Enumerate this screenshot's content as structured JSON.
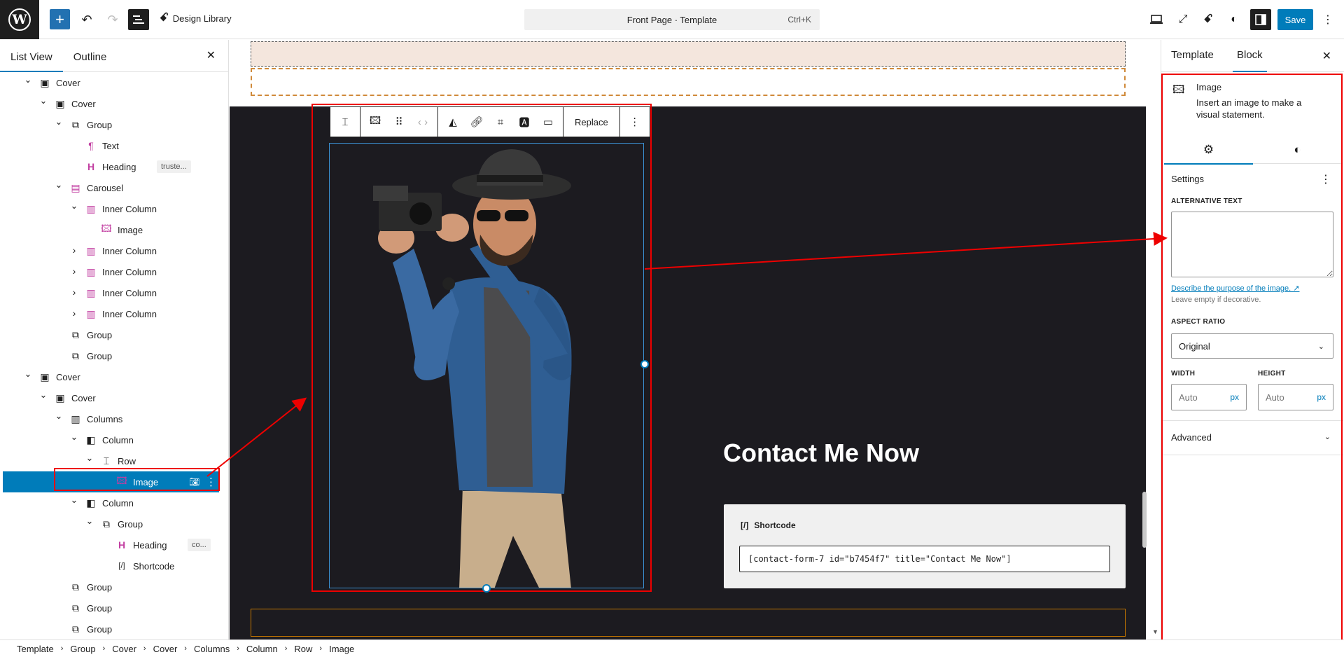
{
  "topbar": {
    "logo_glyph": "W",
    "design_library_label": "Design Library",
    "command_title": "Front Page · Template",
    "command_shortcut": "Ctrl+K",
    "save_label": "Save",
    "icons": [
      "add-block-icon",
      "undo-icon",
      "redo-icon",
      "document-overview-icon",
      "desktop-view-icon",
      "external-link-icon",
      "spectra-icon",
      "styles-icon",
      "settings-sidebar-icon",
      "more-options-icon"
    ]
  },
  "left_panel": {
    "tabs": [
      "List View",
      "Outline"
    ],
    "tree": [
      {
        "label": "Cover",
        "depth": 0,
        "expanded": true,
        "icon": "cover"
      },
      {
        "label": "Cover",
        "depth": 1,
        "expanded": true,
        "icon": "cover"
      },
      {
        "label": "Group",
        "depth": 2,
        "expanded": true,
        "icon": "group"
      },
      {
        "label": "Text",
        "depth": 3,
        "icon": "paragraph"
      },
      {
        "label": "Heading",
        "depth": 3,
        "icon": "heading",
        "badge": "truste..."
      },
      {
        "label": "Carousel",
        "depth": 2,
        "expanded": true,
        "icon": "carousel"
      },
      {
        "label": "Inner Column",
        "depth": 3,
        "expanded": true,
        "icon": "inner-column"
      },
      {
        "label": "Image",
        "depth": 4,
        "icon": "image"
      },
      {
        "label": "Inner Column",
        "depth": 3,
        "expanded": false,
        "icon": "inner-column"
      },
      {
        "label": "Inner Column",
        "depth": 3,
        "expanded": false,
        "icon": "inner-column"
      },
      {
        "label": "Inner Column",
        "depth": 3,
        "expanded": false,
        "icon": "inner-column"
      },
      {
        "label": "Inner Column",
        "depth": 3,
        "expanded": false,
        "icon": "inner-column"
      },
      {
        "label": "Group",
        "depth": 2,
        "icon": "group"
      },
      {
        "label": "Group",
        "depth": 2,
        "icon": "group"
      },
      {
        "label": "Cover",
        "depth": 0,
        "expanded": true,
        "icon": "cover"
      },
      {
        "label": "Cover",
        "depth": 1,
        "expanded": true,
        "icon": "cover"
      },
      {
        "label": "Columns",
        "depth": 2,
        "expanded": true,
        "icon": "columns"
      },
      {
        "label": "Column",
        "depth": 3,
        "expanded": true,
        "icon": "column"
      },
      {
        "label": "Row",
        "depth": 4,
        "expanded": true,
        "icon": "row"
      },
      {
        "label": "Image",
        "depth": 5,
        "icon": "image",
        "selected": true
      },
      {
        "label": "Column",
        "depth": 3,
        "expanded": true,
        "icon": "column"
      },
      {
        "label": "Group",
        "depth": 4,
        "expanded": true,
        "icon": "group"
      },
      {
        "label": "Heading",
        "depth": 5,
        "icon": "heading",
        "badge": "co..."
      },
      {
        "label": "Shortcode",
        "depth": 5,
        "icon": "shortcode"
      },
      {
        "label": "Group",
        "depth": 2,
        "icon": "group"
      },
      {
        "label": "Group",
        "depth": 2,
        "icon": "group"
      },
      {
        "label": "Group",
        "depth": 2,
        "icon": "group"
      }
    ]
  },
  "canvas": {
    "toolbar_replace_label": "Replace",
    "contact_heading": "Contact Me Now",
    "shortcode_label": "Shortcode",
    "shortcode_value": "[contact-form-7 id=\"b7454f7\" title=\"Contact Me Now\"]"
  },
  "right_panel": {
    "tabs": [
      "Template",
      "Block"
    ],
    "block_title": "Image",
    "block_description": "Insert an image to make a visual statement.",
    "settings_label": "Settings",
    "alt_text_label": "ALTERNATIVE TEXT",
    "alt_text_value": "",
    "alt_link": "Describe the purpose of the image. ↗",
    "alt_help": "Leave empty if decorative.",
    "aspect_ratio_label": "ASPECT RATIO",
    "aspect_ratio_value": "Original",
    "width_label": "WIDTH",
    "width_placeholder": "Auto",
    "height_label": "HEIGHT",
    "height_placeholder": "Auto",
    "unit": "px",
    "advanced_label": "Advanced"
  },
  "breadcrumb": [
    "Template",
    "Group",
    "Cover",
    "Cover",
    "Columns",
    "Column",
    "Row",
    "Image"
  ],
  "colors": {
    "accent": "#007cba",
    "block_icon": "#c23ea1",
    "annotation": "#e00000",
    "canvas_dark": "#1c1b20"
  }
}
